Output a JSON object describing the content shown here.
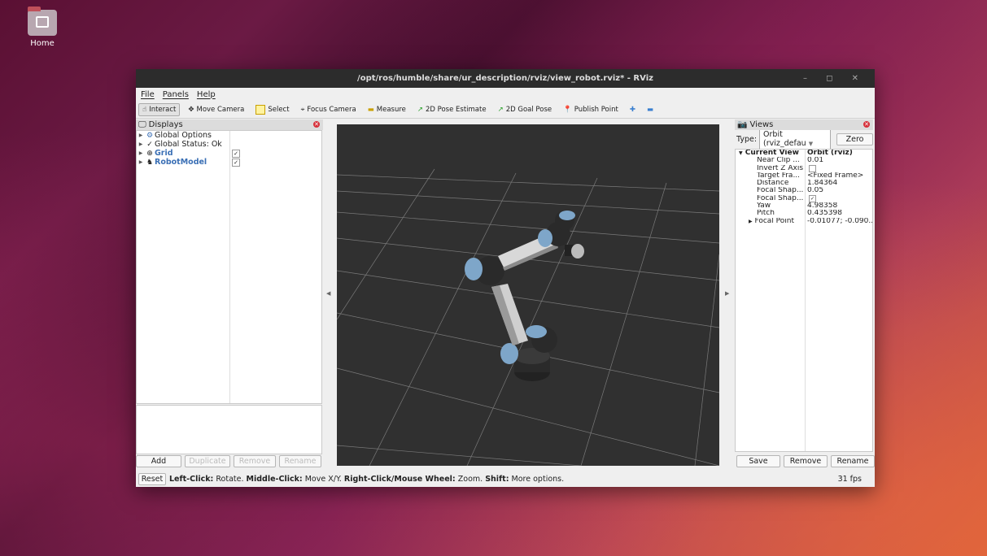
{
  "desktop": {
    "home_label": "Home"
  },
  "window": {
    "title": "/opt/ros/humble/share/ur_description/rviz/view_robot.rviz* - RViz",
    "controls": "– ◻ ✕"
  },
  "menu": {
    "file": "File",
    "panels": "Panels",
    "help": "Help"
  },
  "toolbar": {
    "interact": "Interact",
    "move_camera": "Move Camera",
    "select": "Select",
    "focus_camera": "Focus Camera",
    "measure": "Measure",
    "pose_estimate": "2D Pose Estimate",
    "goal_pose": "2D Goal Pose",
    "publish_point": "Publish Point"
  },
  "displays": {
    "title": "Displays",
    "items": [
      {
        "label": "Global Options",
        "checked": null
      },
      {
        "label": "Global Status: Ok",
        "checked": null
      },
      {
        "label": "Grid",
        "checked": true
      },
      {
        "label": "RobotModel",
        "checked": true
      }
    ],
    "buttons": {
      "add": "Add",
      "duplicate": "Duplicate",
      "remove": "Remove",
      "rename": "Rename"
    }
  },
  "views": {
    "title": "Views",
    "type_label": "Type:",
    "type_value": "Orbit (rviz_defau",
    "zero": "Zero",
    "current_view": "Current View",
    "current_view_value": "Orbit (rviz)",
    "props": [
      {
        "k": "Near Clip ...",
        "v": "0.01"
      },
      {
        "k": "Invert Z Axis",
        "v": ""
      },
      {
        "k": "Target Fra...",
        "v": "<Fixed Frame>"
      },
      {
        "k": "Distance",
        "v": "1.84364"
      },
      {
        "k": "Focal Shap...",
        "v": "0.05"
      },
      {
        "k": "Focal Shap...",
        "v": ""
      },
      {
        "k": "Yaw",
        "v": "4.98358"
      },
      {
        "k": "Pitch",
        "v": "0.435398"
      },
      {
        "k": "Focal Point",
        "v": "-0.01077; -0.090..."
      }
    ],
    "buttons": {
      "save": "Save",
      "remove": "Remove",
      "rename": "Rename"
    }
  },
  "status": {
    "reset": "Reset",
    "b1": "Left-Click:",
    "t1": " Rotate. ",
    "b2": "Middle-Click:",
    "t2": " Move X/Y. ",
    "b3": "Right-Click/Mouse Wheel:",
    "t3": " Zoom. ",
    "b4": "Shift:",
    "t4": " More options.",
    "fps": "31 fps"
  }
}
